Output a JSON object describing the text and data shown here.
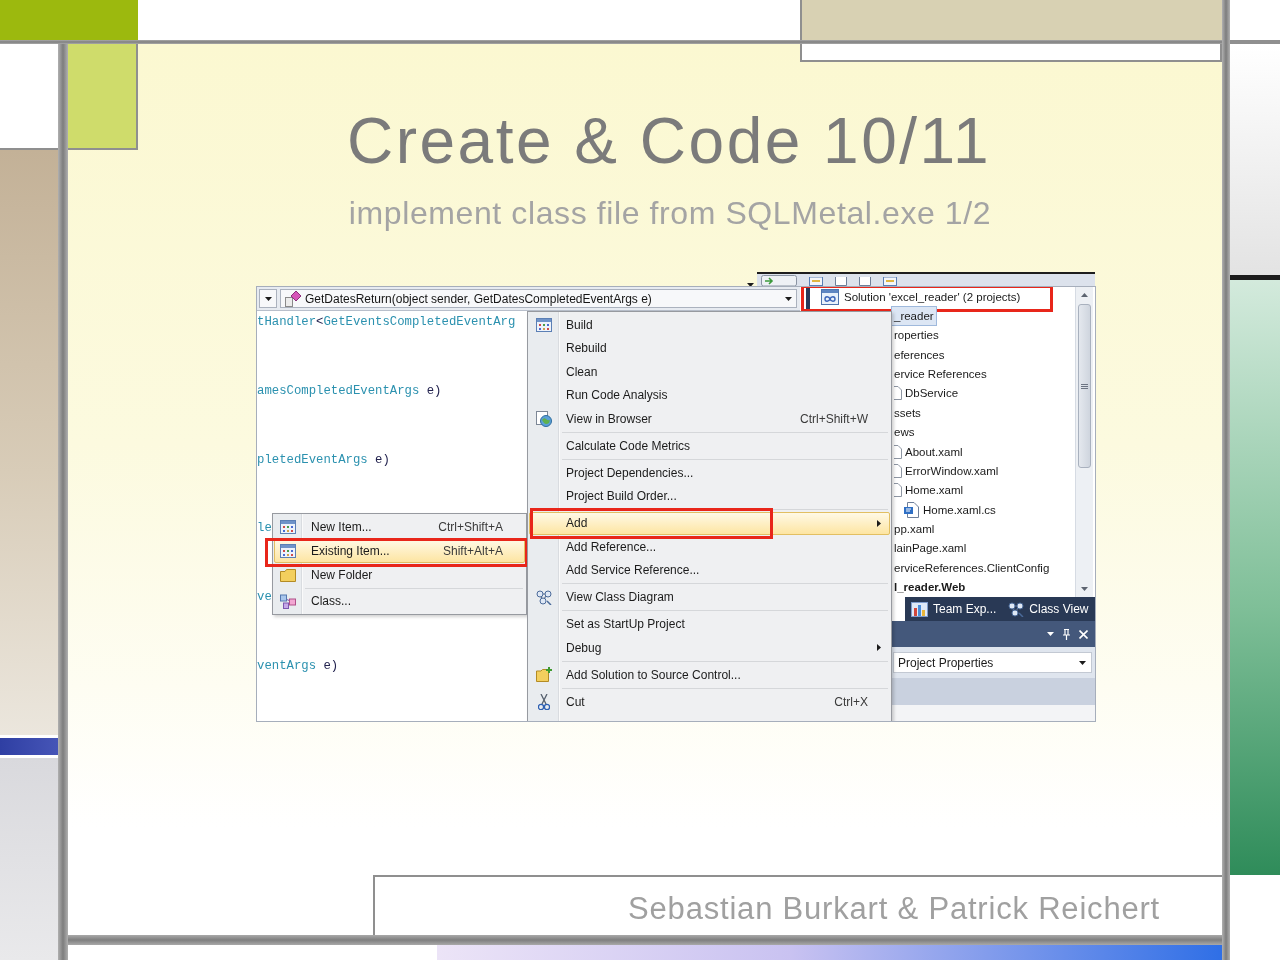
{
  "slide": {
    "title": "Create & Code 10/11",
    "subtitle": "implement class file from SQLMetal.exe 1/2"
  },
  "ide": {
    "method_bar": {
      "member": "GetDatesReturn(object sender, GetDatesCompletedEventArgs e)"
    },
    "code_lines": [
      {
        "segments": [
          {
            "kind": "type",
            "text": "tHandler"
          },
          {
            "kind": "plain",
            "text": "<"
          },
          {
            "kind": "type",
            "text": "GetEventsCompletedEventArg"
          }
        ]
      },
      {
        "segments": [
          {
            "kind": "type",
            "text": "amesCompletedEventArgs"
          },
          {
            "kind": "plain",
            "text": " e)"
          }
        ]
      },
      {
        "segments": [
          {
            "kind": "type",
            "text": "pletedEventArgs"
          },
          {
            "kind": "plain",
            "text": " e)"
          }
        ]
      },
      {
        "segments": [
          {
            "kind": "type",
            "text": "le"
          }
        ]
      },
      {
        "segments": [
          {
            "kind": "type",
            "text": "ve"
          }
        ]
      },
      {
        "segments": [
          {
            "kind": "type",
            "text": "ventArgs"
          },
          {
            "kind": "plain",
            "text": " e)"
          }
        ]
      }
    ],
    "add_submenu": {
      "items": [
        {
          "kind": "item",
          "label": "New Item...",
          "shortcut": "Ctrl+Shift+A",
          "highlighted": false,
          "marked": false
        },
        {
          "kind": "item",
          "label": "Existing Item...",
          "shortcut": "Shift+Alt+A",
          "highlighted": true,
          "marked": true
        },
        {
          "kind": "item",
          "label": "New Folder",
          "highlighted": false,
          "marked": false
        },
        {
          "kind": "separator"
        },
        {
          "kind": "item",
          "label": "Class...",
          "highlighted": false,
          "marked": false
        }
      ]
    },
    "context_menu": {
      "items": [
        {
          "kind": "item",
          "label": "Build",
          "highlighted": false,
          "marked": false
        },
        {
          "kind": "item",
          "label": "Rebuild",
          "highlighted": false,
          "marked": false
        },
        {
          "kind": "item",
          "label": "Clean",
          "highlighted": false,
          "marked": false
        },
        {
          "kind": "item",
          "label": "Run Code Analysis",
          "highlighted": false,
          "marked": false
        },
        {
          "kind": "item",
          "label": "View in Browser",
          "shortcut": "Ctrl+Shift+W",
          "highlighted": false,
          "marked": false
        },
        {
          "kind": "separator"
        },
        {
          "kind": "item",
          "label": "Calculate Code Metrics",
          "highlighted": false,
          "marked": false
        },
        {
          "kind": "separator"
        },
        {
          "kind": "item",
          "label": "Project Dependencies...",
          "highlighted": false,
          "marked": false
        },
        {
          "kind": "item",
          "label": "Project Build Order...",
          "highlighted": false,
          "marked": false
        },
        {
          "kind": "separator"
        },
        {
          "kind": "submenu",
          "label": "Add",
          "highlighted": true,
          "marked": true
        },
        {
          "kind": "item",
          "label": "Add Reference...",
          "highlighted": false,
          "marked": false
        },
        {
          "kind": "item",
          "label": "Add Service Reference...",
          "highlighted": false,
          "marked": false
        },
        {
          "kind": "separator"
        },
        {
          "kind": "item",
          "label": "View Class Diagram",
          "highlighted": false,
          "marked": false
        },
        {
          "kind": "separator"
        },
        {
          "kind": "item",
          "label": "Set as StartUp Project",
          "highlighted": false,
          "marked": false
        },
        {
          "kind": "submenu",
          "label": "Debug",
          "highlighted": false,
          "marked": false
        },
        {
          "kind": "separator"
        },
        {
          "kind": "item",
          "label": "Add Solution to Source Control...",
          "highlighted": false,
          "marked": false
        },
        {
          "kind": "separator"
        },
        {
          "kind": "item",
          "label": "Cut",
          "shortcut": "Ctrl+X",
          "highlighted": false,
          "marked": false
        }
      ]
    },
    "solution_explorer": {
      "tree": [
        {
          "label": "Solution 'excel_reader' (2 projects)",
          "selected": false,
          "marked": true,
          "children": [
            {
              "label": "_reader",
              "selected": true,
              "startup": false,
              "children": [
                {
                  "label": "roperties",
                  "selected": false
                },
                {
                  "label": "eferences",
                  "selected": false
                },
                {
                  "label": "ervice References",
                  "selected": false,
                  "children": [
                    {
                      "label": "DbService",
                      "selected": false
                    }
                  ]
                },
                {
                  "label": "ssets",
                  "selected": false
                },
                {
                  "label": "ews",
                  "selected": false,
                  "children": [
                    {
                      "label": "About.xaml",
                      "selected": false
                    },
                    {
                      "label": "ErrorWindow.xaml",
                      "selected": false
                    },
                    {
                      "label": "Home.xaml",
                      "selected": false,
                      "children": [
                        {
                          "label": "Home.xaml.cs",
                          "selected": false
                        }
                      ]
                    }
                  ]
                },
                {
                  "label": "pp.xaml",
                  "selected": false
                },
                {
                  "label": "lainPage.xaml",
                  "selected": false
                },
                {
                  "label": "erviceReferences.ClientConfig",
                  "selected": false
                }
              ]
            },
            {
              "label": "l_reader.Web",
              "selected": false,
              "startup": true
            }
          ]
        }
      ],
      "tabs": [
        {
          "label": "Team Exp...",
          "selected": false
        },
        {
          "label": "Class View",
          "selected": false
        }
      ]
    },
    "properties": {
      "selector": "Project Properties"
    }
  },
  "footer": "Sebastian Burkart & Patrick Reichert"
}
